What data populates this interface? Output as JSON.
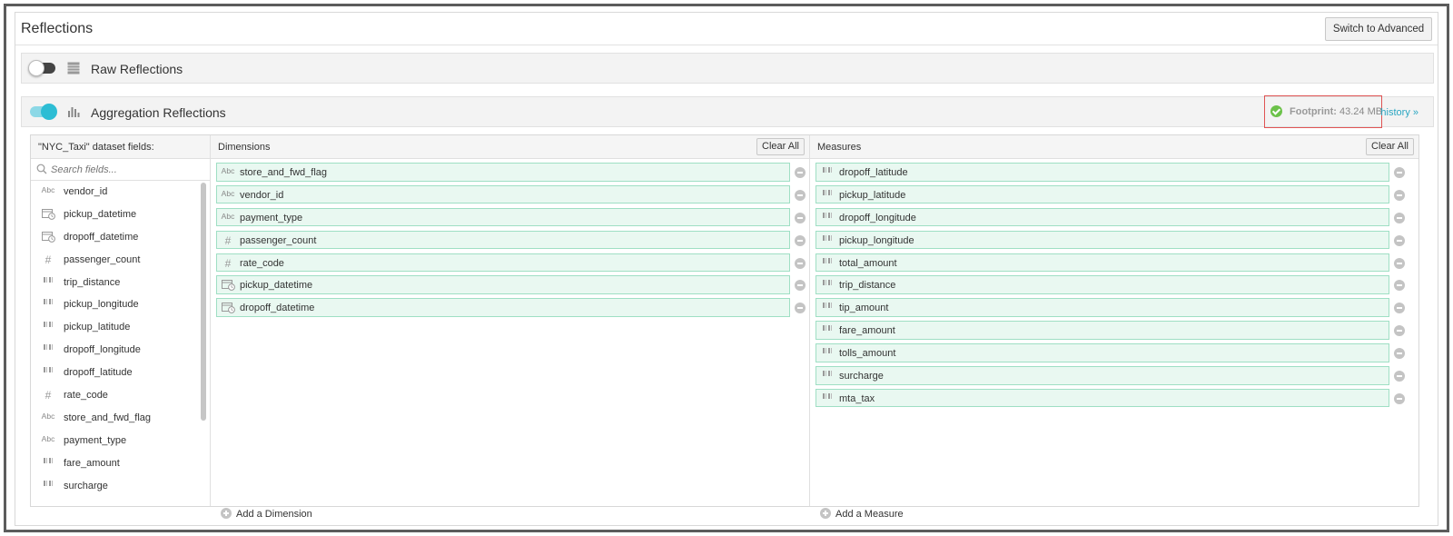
{
  "header": {
    "title": "Reflections",
    "switch_label": "Switch to Advanced"
  },
  "raw_section": {
    "label": "Raw Reflections",
    "enabled": false
  },
  "agg_section": {
    "label": "Aggregation Reflections",
    "enabled": true,
    "footprint_label": "Footprint:",
    "footprint_value": "43.24 MB",
    "history_link": "history »"
  },
  "fields": {
    "title": "\"NYC_Taxi\" dataset fields:",
    "search_placeholder": "Search fields...",
    "items": [
      {
        "name": "vendor_id",
        "type": "text"
      },
      {
        "name": "pickup_datetime",
        "type": "datetime"
      },
      {
        "name": "dropoff_datetime",
        "type": "datetime"
      },
      {
        "name": "passenger_count",
        "type": "integer"
      },
      {
        "name": "trip_distance",
        "type": "decimal"
      },
      {
        "name": "pickup_longitude",
        "type": "decimal"
      },
      {
        "name": "pickup_latitude",
        "type": "decimal"
      },
      {
        "name": "dropoff_longitude",
        "type": "decimal"
      },
      {
        "name": "dropoff_latitude",
        "type": "decimal"
      },
      {
        "name": "rate_code",
        "type": "integer"
      },
      {
        "name": "store_and_fwd_flag",
        "type": "text"
      },
      {
        "name": "payment_type",
        "type": "text"
      },
      {
        "name": "fare_amount",
        "type": "decimal"
      },
      {
        "name": "surcharge",
        "type": "decimal"
      }
    ]
  },
  "dimensions": {
    "title": "Dimensions",
    "clear_label": "Clear All",
    "add_label": "Add a Dimension",
    "items": [
      {
        "name": "store_and_fwd_flag",
        "type": "text"
      },
      {
        "name": "vendor_id",
        "type": "text"
      },
      {
        "name": "payment_type",
        "type": "text"
      },
      {
        "name": "passenger_count",
        "type": "integer"
      },
      {
        "name": "rate_code",
        "type": "integer"
      },
      {
        "name": "pickup_datetime",
        "type": "datetime"
      },
      {
        "name": "dropoff_datetime",
        "type": "datetime"
      }
    ]
  },
  "measures": {
    "title": "Measures",
    "clear_label": "Clear All",
    "add_label": "Add a Measure",
    "items": [
      {
        "name": "dropoff_latitude",
        "type": "decimal"
      },
      {
        "name": "pickup_latitude",
        "type": "decimal"
      },
      {
        "name": "dropoff_longitude",
        "type": "decimal"
      },
      {
        "name": "pickup_longitude",
        "type": "decimal"
      },
      {
        "name": "total_amount",
        "type": "decimal"
      },
      {
        "name": "trip_distance",
        "type": "decimal"
      },
      {
        "name": "tip_amount",
        "type": "decimal"
      },
      {
        "name": "fare_amount",
        "type": "decimal"
      },
      {
        "name": "tolls_amount",
        "type": "decimal"
      },
      {
        "name": "surcharge",
        "type": "decimal"
      },
      {
        "name": "mta_tax",
        "type": "decimal"
      }
    ]
  },
  "type_icons": {
    "text": "text-type-icon",
    "datetime": "datetime-type-icon",
    "integer": "integer-type-icon",
    "decimal": "decimal-type-icon"
  },
  "colors": {
    "accent": "#2dbdd4",
    "chip_bg": "#e9f8f1",
    "chip_border": "#9fdfc4",
    "ok": "#6cc24a",
    "highlight": "#e05353"
  }
}
